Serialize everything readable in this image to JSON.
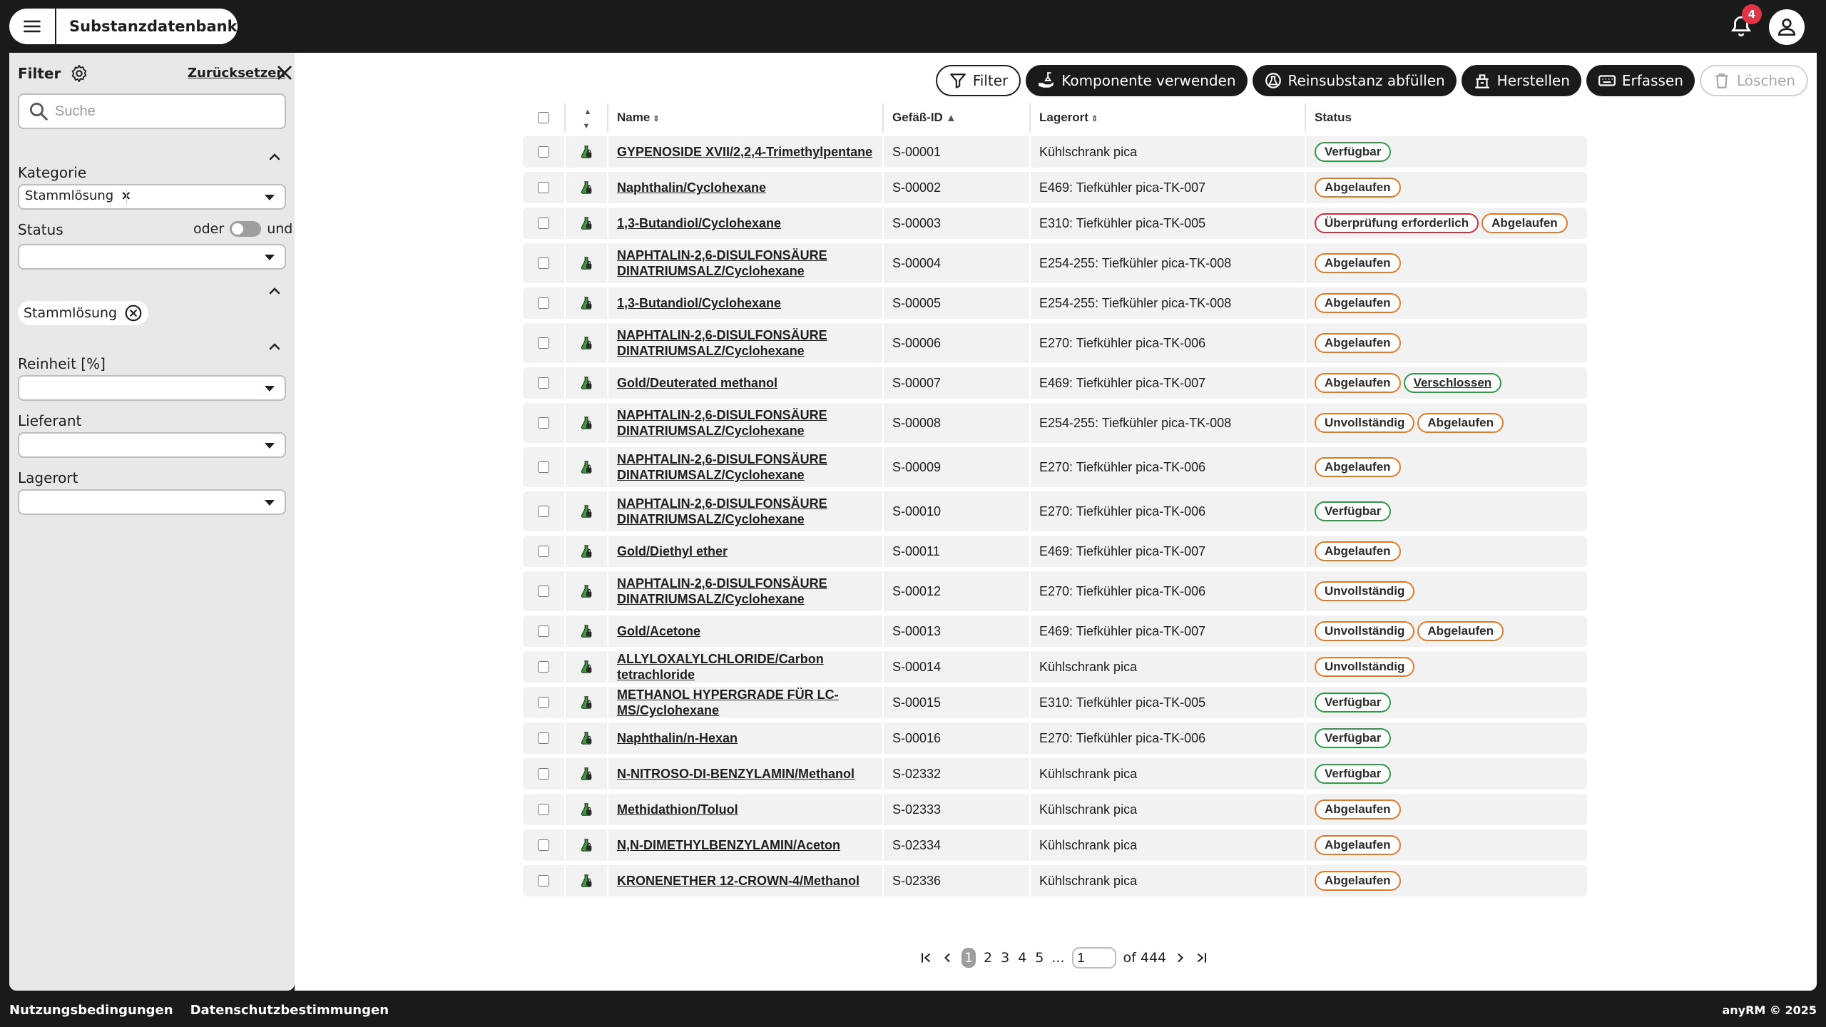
{
  "app": {
    "title": "Substanzdatenbank",
    "notifications": "4"
  },
  "sidebar": {
    "title": "Filter",
    "reset": "Zurücksetzen",
    "search_placeholder": "Suche",
    "kategorie_label": "Kategorie",
    "kategorie_value": "Stammlösung",
    "status_label": "Status",
    "toggle_or": "oder",
    "toggle_and": "und",
    "active_tag": "Stammlösung",
    "reinheit_label": "Reinheit [%]",
    "lieferant_label": "Lieferant",
    "lagerort_label": "Lagerort"
  },
  "toolbar": {
    "filter": "Filter",
    "komponente": "Komponente verwenden",
    "reinsubstanz": "Reinsubstanz abfüllen",
    "herstellen": "Herstellen",
    "erfassen": "Erfassen",
    "loeschen": "Löschen"
  },
  "table": {
    "headers": {
      "name": "Name",
      "id": "Gefäß-ID",
      "location": "Lagerort",
      "status": "Status"
    },
    "rows": [
      {
        "name": "GYPENOSIDE XVII/2,2,4-Trimethylpentane",
        "id": "S-00001",
        "location": "Kühlschrank pica",
        "status": [
          {
            "t": "Verfügbar",
            "c": "green"
          }
        ]
      },
      {
        "name": "Naphthalin/Cyclohexane",
        "id": "S-00002",
        "location": "E469: Tiefkühler pica-TK-007",
        "status": [
          {
            "t": "Abgelaufen",
            "c": "orange"
          }
        ]
      },
      {
        "name": "1,3-Butandiol/Cyclohexane",
        "id": "S-00003",
        "location": "E310: Tiefkühler pica-TK-005",
        "status": [
          {
            "t": "Überprüfung erforderlich",
            "c": "red"
          },
          {
            "t": "Abgelaufen",
            "c": "orange"
          }
        ]
      },
      {
        "name": "NAPHTALIN-2,6-DISULFONSÄURE DINATRIUMSALZ/Cyclohexane",
        "id": "S-00004",
        "location": "E254-255: Tiefkühler pica-TK-008",
        "status": [
          {
            "t": "Abgelaufen",
            "c": "orange"
          }
        ]
      },
      {
        "name": "1,3-Butandiol/Cyclohexane",
        "id": "S-00005",
        "location": "E254-255: Tiefkühler pica-TK-008",
        "status": [
          {
            "t": "Abgelaufen",
            "c": "orange"
          }
        ]
      },
      {
        "name": "NAPHTALIN-2,6-DISULFONSÄURE DINATRIUMSALZ/Cyclohexane",
        "id": "S-00006",
        "location": "E270: Tiefkühler pica-TK-006",
        "status": [
          {
            "t": "Abgelaufen",
            "c": "orange"
          }
        ]
      },
      {
        "name": "Gold/Deuterated methanol",
        "id": "S-00007",
        "location": "E469: Tiefkühler pica-TK-007",
        "status": [
          {
            "t": "Abgelaufen",
            "c": "orange"
          },
          {
            "t": "Verschlossen",
            "c": "lock"
          }
        ]
      },
      {
        "name": "NAPHTALIN-2,6-DISULFONSÄURE DINATRIUMSALZ/Cyclohexane",
        "id": "S-00008",
        "location": "E254-255: Tiefkühler pica-TK-008",
        "status": [
          {
            "t": "Unvollständig",
            "c": "orange"
          },
          {
            "t": "Abgelaufen",
            "c": "orange"
          }
        ]
      },
      {
        "name": "NAPHTALIN-2,6-DISULFONSÄURE DINATRIUMSALZ/Cyclohexane",
        "id": "S-00009",
        "location": "E270: Tiefkühler pica-TK-006",
        "status": [
          {
            "t": "Abgelaufen",
            "c": "orange"
          }
        ]
      },
      {
        "name": "NAPHTALIN-2,6-DISULFONSÄURE DINATRIUMSALZ/Cyclohexane",
        "id": "S-00010",
        "location": "E270: Tiefkühler pica-TK-006",
        "status": [
          {
            "t": "Verfügbar",
            "c": "green"
          }
        ]
      },
      {
        "name": "Gold/Diethyl ether",
        "id": "S-00011",
        "location": "E469: Tiefkühler pica-TK-007",
        "status": [
          {
            "t": "Abgelaufen",
            "c": "orange"
          }
        ]
      },
      {
        "name": "NAPHTALIN-2,6-DISULFONSÄURE DINATRIUMSALZ/Cyclohexane",
        "id": "S-00012",
        "location": "E270: Tiefkühler pica-TK-006",
        "status": [
          {
            "t": "Unvollständig",
            "c": "orange"
          }
        ]
      },
      {
        "name": "Gold/Acetone",
        "id": "S-00013",
        "location": "E469: Tiefkühler pica-TK-007",
        "status": [
          {
            "t": "Unvollständig",
            "c": "orange"
          },
          {
            "t": "Abgelaufen",
            "c": "orange"
          }
        ]
      },
      {
        "name": "ALLYLOXALYLCHLORIDE/Carbon tetrachloride",
        "id": "S-00014",
        "location": "Kühlschrank pica",
        "status": [
          {
            "t": "Unvollständig",
            "c": "orange"
          }
        ]
      },
      {
        "name": "METHANOL HYPERGRADE FÜR LC-MS/Cyclohexane",
        "id": "S-00015",
        "location": "E310: Tiefkühler pica-TK-005",
        "status": [
          {
            "t": "Verfügbar",
            "c": "green"
          }
        ]
      },
      {
        "name": "Naphthalin/n-Hexan",
        "id": "S-00016",
        "location": "E270: Tiefkühler pica-TK-006",
        "status": [
          {
            "t": "Verfügbar",
            "c": "green"
          }
        ]
      },
      {
        "name": "N-NITROSO-DI-BENZYLAMIN/Methanol",
        "id": "S-02332",
        "location": "Kühlschrank pica",
        "status": [
          {
            "t": "Verfügbar",
            "c": "green"
          }
        ]
      },
      {
        "name": "Methidathion/Toluol",
        "id": "S-02333",
        "location": "Kühlschrank pica",
        "status": [
          {
            "t": "Abgelaufen",
            "c": "orange"
          }
        ]
      },
      {
        "name": "N,N-DIMETHYLBENZYLAMIN/Aceton",
        "id": "S-02334",
        "location": "Kühlschrank pica",
        "status": [
          {
            "t": "Abgelaufen",
            "c": "orange"
          }
        ]
      },
      {
        "name": "KRONENETHER 12-CROWN-4/Methanol",
        "id": "S-02336",
        "location": "Kühlschrank pica",
        "status": [
          {
            "t": "Abgelaufen",
            "c": "orange"
          }
        ]
      }
    ]
  },
  "pager": {
    "pages": [
      "1",
      "2",
      "3",
      "4",
      "5"
    ],
    "ellipsis": "...",
    "current": "1",
    "of_text": "of 444"
  },
  "footer": {
    "terms": "Nutzungsbedingungen",
    "privacy": "Datenschutzbestimmungen",
    "copyright": "anyRM © 2025"
  },
  "colors": {
    "green": "#2e9a4a",
    "orange": "#e07a2a",
    "red": "#d03040",
    "dark": "#1a1a1a"
  }
}
